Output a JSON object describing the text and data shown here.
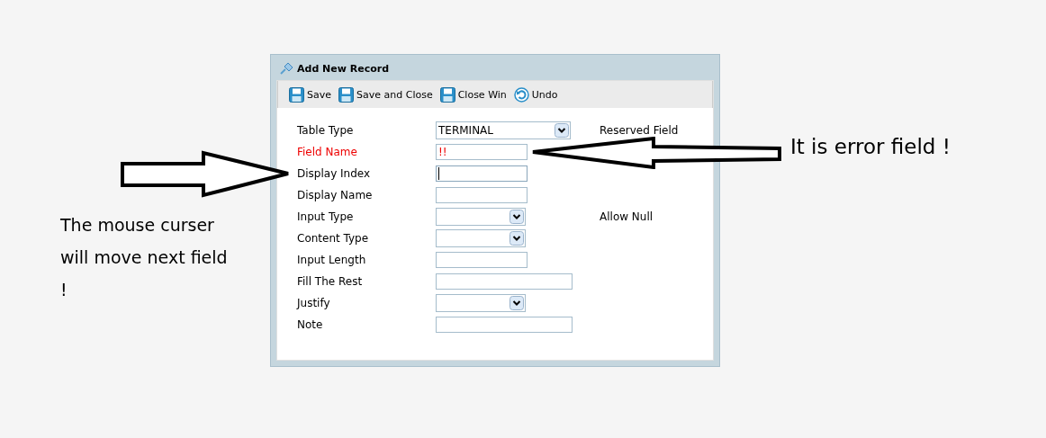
{
  "window": {
    "title": "Add New Record"
  },
  "toolbar": [
    {
      "label": "Save",
      "kind": "save"
    },
    {
      "label": "Save and Close",
      "kind": "save"
    },
    {
      "label": "Close Win",
      "kind": "save"
    },
    {
      "label": "Undo",
      "kind": "undo"
    }
  ],
  "fields": [
    {
      "label": "Table Type",
      "kind": "wide-select",
      "value": "TERMINAL",
      "error": false,
      "focused": false,
      "note": "Reserved Field"
    },
    {
      "label": "Field Name",
      "kind": "text",
      "value": "!!",
      "error": true,
      "focused": false
    },
    {
      "label": "Display Index",
      "kind": "text",
      "error": false,
      "focused": true
    },
    {
      "label": "Display Name",
      "kind": "text",
      "error": false,
      "focused": false
    },
    {
      "label": "Input Type",
      "kind": "select",
      "error": false,
      "focused": false,
      "note": "Allow Null"
    },
    {
      "label": "Content Type",
      "kind": "select",
      "error": false,
      "focused": false
    },
    {
      "label": "Input Length",
      "kind": "text",
      "error": false,
      "focused": false
    },
    {
      "label": "Fill The Rest",
      "kind": "wide-text",
      "error": false,
      "focused": false
    },
    {
      "label": "Justify",
      "kind": "select",
      "error": false,
      "focused": false
    },
    {
      "label": "Note",
      "kind": "wide-text",
      "error": false,
      "focused": false
    }
  ],
  "annotations": [
    {
      "text": "It is error field !",
      "kind": "error-arrow"
    },
    {
      "text": "The mouse curser will move next field !",
      "kind": "cursor-arrow"
    }
  ]
}
